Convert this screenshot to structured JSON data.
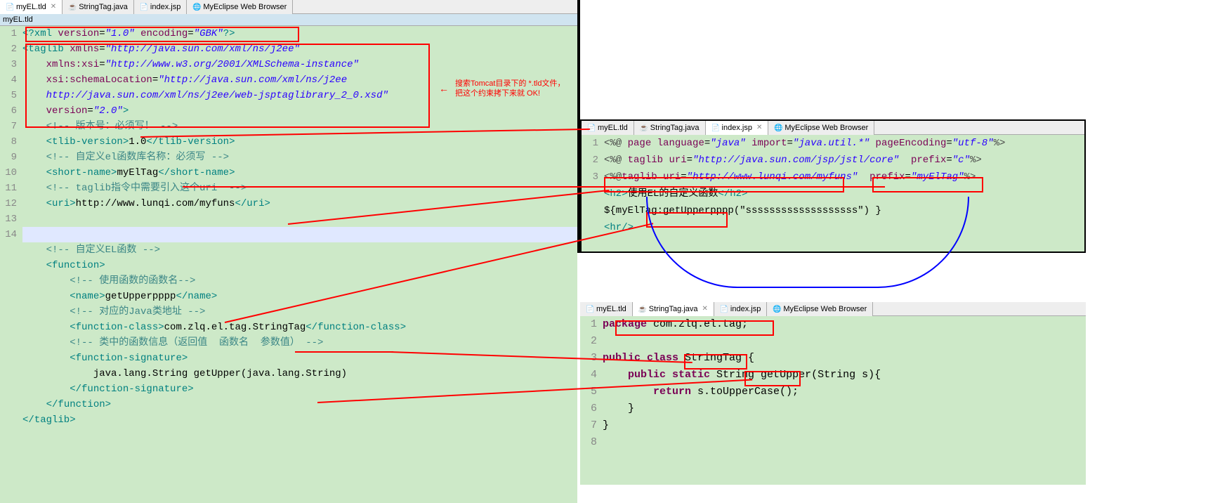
{
  "leftPane": {
    "tabs": [
      {
        "label": "myEL.tld",
        "iconClass": "ico-xml",
        "active": true,
        "closable": true
      },
      {
        "label": "StringTag.java",
        "iconClass": "ico-java",
        "active": false,
        "closable": false
      },
      {
        "label": "index.jsp",
        "iconClass": "ico-jsp",
        "active": false,
        "closable": false
      },
      {
        "label": "MyEclipse Web Browser",
        "iconClass": "ico-browser",
        "active": false,
        "closable": false
      }
    ],
    "titleStrip": "myEL.tld",
    "lines": {
      "l1": {
        "n": "1",
        "html": "<span class='tag'>&lt;?xml</span> <span class='attr'>version</span>=<span class='str'>\"1.0\"</span> <span class='attr'>encoding</span>=<span class='str'>\"GBK\"</span><span class='tag'>?&gt;</span>"
      },
      "l2": {
        "n": "2",
        "html": "<span class='tag'>&lt;taglib</span> <span class='attr'>xmlns</span>=<span class='str'>\"http://java.sun.com/xml/ns/j2ee\"</span>"
      },
      "l3": {
        "n": "3",
        "html": "    <span class='attr'>xmlns:xsi</span>=<span class='str'>\"http://www.w3.org/2001/XMLSchema-instance\"</span>"
      },
      "l4": {
        "n": "4",
        "html": "    <span class='attr'>xsi:schemaLocation</span>=<span class='str'>\"http://java.sun.com/xml/ns/j2ee</span>"
      },
      "l5": {
        "n": "5",
        "html": "    <span class='str'>http://java.sun.com/xml/ns/j2ee/web-jsptaglibrary_2_0.xsd\"</span>"
      },
      "l6": {
        "n": "6",
        "html": "    <span class='attr'>version</span>=<span class='str'>\"2.0\"</span><span class='tag'>&gt;</span>"
      },
      "l7": {
        "n": "7",
        "html": "    <span class='cmt'>&lt;!-- 版本号：必须写！ --&gt;</span>"
      },
      "l8": {
        "n": "8",
        "html": "    <span class='tag'>&lt;tlib-version&gt;</span>1.0<span class='tag'>&lt;/tlib-version&gt;</span>"
      },
      "l9": {
        "n": "9",
        "html": "    <span class='cmt'>&lt;!-- 自定义el函数库名称：必须写 --&gt;</span>"
      },
      "l10": {
        "n": "10",
        "html": "    <span class='tag'>&lt;short-name&gt;</span>myElTag<span class='tag'>&lt;/short-name&gt;</span>"
      },
      "l11": {
        "n": "11",
        "html": "    <span class='cmt'>&lt;!-- taglib指令中需要引入这个uri  --&gt;</span>"
      },
      "l12": {
        "n": "12",
        "html": "    <span class='tag'>&lt;uri&gt;</span>http://www.lunqi.com/myfuns<span class='tag'>&lt;/uri&gt;</span>"
      },
      "l13": {
        "n": "13",
        "html": ""
      },
      "l14": {
        "n": "14",
        "html": ""
      },
      "l15": {
        "n": "",
        "html": "    <span class='cmt'>&lt;!-- 自定义EL函数 --&gt;</span>"
      },
      "l16": {
        "n": "",
        "html": "    <span class='tag'>&lt;function&gt;</span>"
      },
      "l17": {
        "n": "",
        "html": "        <span class='cmt'>&lt;!-- 使用函数的函数名--&gt;</span>"
      },
      "l18": {
        "n": "",
        "html": "        <span class='tag'>&lt;name&gt;</span>getUpperpppp<span class='tag'>&lt;/name&gt;</span>"
      },
      "l19": {
        "n": "",
        "html": "        <span class='cmt'>&lt;!-- 对应的Java类地址 --&gt;</span>"
      },
      "l20": {
        "n": "",
        "html": "        <span class='tag'>&lt;function-class&gt;</span>com.zlq.el.tag.StringTag<span class='tag'>&lt;/function-class&gt;</span>"
      },
      "l21": {
        "n": "",
        "html": "        <span class='cmt'>&lt;!-- 类中的函数信息（返回值  函数名  参数值） --&gt;</span>"
      },
      "l22": {
        "n": "",
        "html": "        <span class='tag'>&lt;function-signature&gt;</span>"
      },
      "l23": {
        "n": "",
        "html": "            java.lang.String getUpper(java.lang.String)"
      },
      "l24": {
        "n": "",
        "html": "        <span class='tag'>&lt;/function-signature&gt;</span>"
      },
      "l25": {
        "n": "",
        "html": "    <span class='tag'>&lt;/function&gt;</span>"
      },
      "l26": {
        "n": "",
        "html": "<span class='tag'>&lt;/taglib&gt;</span>"
      }
    }
  },
  "note": {
    "text": "搜索Tomcat目录下的\n*.tld文件，把这个约束拷下来就\nOK!"
  },
  "topRight": {
    "tabs": [
      {
        "label": "myEL.tld",
        "iconClass": "ico-xml",
        "active": false
      },
      {
        "label": "StringTag.java",
        "iconClass": "ico-java",
        "active": false
      },
      {
        "label": "index.jsp",
        "iconClass": "ico-jsp",
        "active": true,
        "closable": true
      },
      {
        "label": "MyEclipse Web Browser",
        "iconClass": "ico-browser",
        "active": false
      }
    ],
    "lines": {
      "l1": {
        "n": "1",
        "html": "<span class='directive'>&lt;%@</span> <span class='attr'>page</span> <span class='attr'>language</span>=<span class='str'>\"java\"</span> <span class='attr'>import</span>=<span class='str'>\"java.util.*\"</span> <span class='attr'>pageEncoding</span>=<span class='str'>\"utf-8\"</span><span class='directive'>%&gt;</span>"
      },
      "l2": {
        "n": "2",
        "html": "<span class='directive'>&lt;%@</span> <span class='attr'>taglib</span> <span class='attr'>uri</span>=<span class='str'>\"http://java.sun.com/jsp/jstl/core\"</span>  <span class='attr'>prefix</span>=<span class='str'>\"c\"</span><span class='directive'>%&gt;</span>"
      },
      "l3": {
        "n": "3",
        "html": "<span class='directive'>&lt;%@</span><span class='attr'>taglib</span> <span class='attr'>uri</span>=<span class='str'>\"http://www.lunqi.com/myfuns\"</span>  <span class='attr'>prefix</span>=<span class='str'>\"myElTag\"</span><span class='directive'>%&gt;</span>"
      },
      "l4": {
        "n": "",
        "html": "<span class='tag'>&lt;h2&gt;</span>使用EL的自定义函数<span class='tag'>&lt;/h2&gt;</span>"
      },
      "l5": {
        "n": "",
        "html": "${myElTag:getUpperpppp(\"sssssssssssssssssss\") }"
      },
      "l6": {
        "n": "",
        "html": "<span class='tag'>&lt;hr/&gt;</span>"
      }
    }
  },
  "bottomRight": {
    "tabs": [
      {
        "label": "myEL.tld",
        "iconClass": "ico-xml",
        "active": false
      },
      {
        "label": "StringTag.java",
        "iconClass": "ico-java",
        "active": true,
        "closable": true
      },
      {
        "label": "index.jsp",
        "iconClass": "ico-jsp",
        "active": false
      },
      {
        "label": "MyEclipse Web Browser",
        "iconClass": "ico-browser",
        "active": false
      }
    ],
    "lines": {
      "l1": {
        "n": "1",
        "html": "<span class='kw'>package</span> com.zlq.el.tag;"
      },
      "l2": {
        "n": "2",
        "html": ""
      },
      "l3": {
        "n": "3",
        "html": "<span class='kw'>public class</span> StringTag {"
      },
      "l4": {
        "n": "4",
        "html": "    <span class='kw'>public static</span> String getUpper(String s){"
      },
      "l5": {
        "n": "5",
        "html": "        <span class='kw'>return</span> s.toUpperCase();"
      },
      "l6": {
        "n": "6",
        "html": "    }"
      },
      "l7": {
        "n": "7",
        "html": "}"
      },
      "l8": {
        "n": "8",
        "html": ""
      }
    }
  }
}
